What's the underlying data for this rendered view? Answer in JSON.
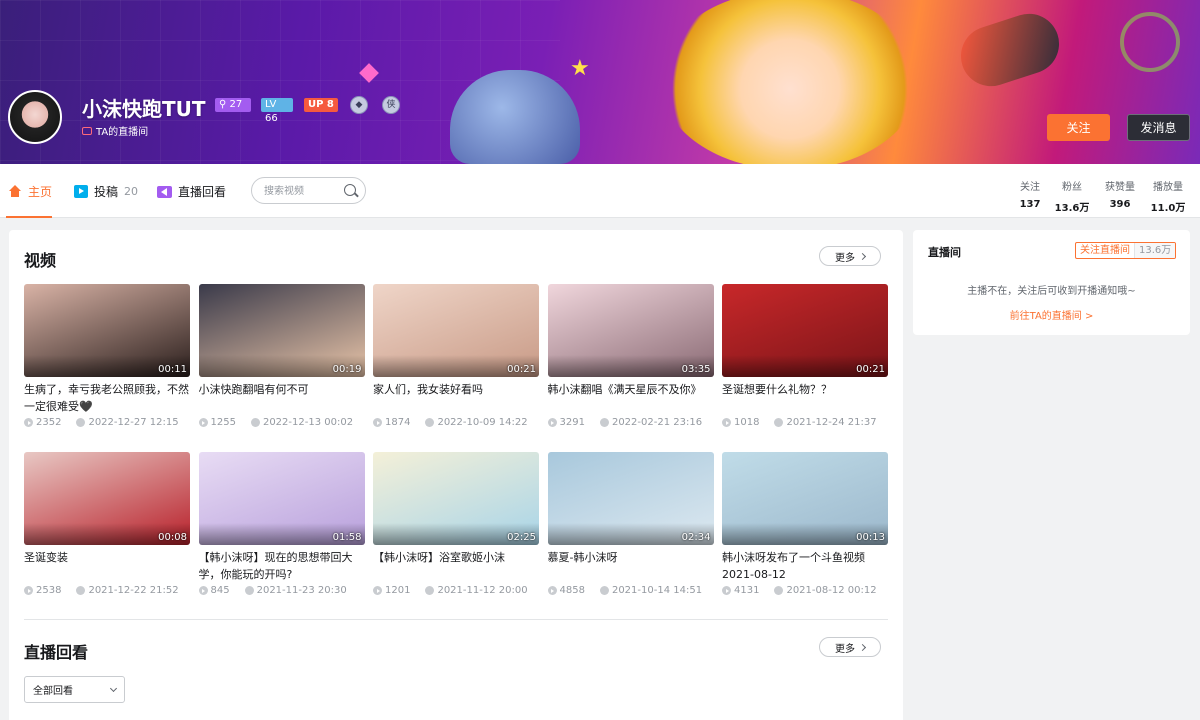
{
  "profile": {
    "name": "小沫快跑TUT",
    "fans_badge": "27",
    "level": "LV 66",
    "up_badge": "UP 8",
    "live_link": "TA的直播间",
    "follow_btn": "关注",
    "message_btn": "发消息"
  },
  "nav": {
    "home": "主页",
    "posts": "投稿",
    "posts_count": "20",
    "replay": "直播回看",
    "search_placeholder": "搜索视频"
  },
  "stats": [
    {
      "label": "关注",
      "value": "137"
    },
    {
      "label": "粉丝",
      "value": "13.6万"
    },
    {
      "label": "获赞量",
      "value": "396"
    },
    {
      "label": "播放量",
      "value": "11.0万"
    }
  ],
  "videos_section": {
    "title": "视频",
    "more": "更多"
  },
  "videos": [
    {
      "title": "生病了，幸亏我老公照顾我，不然一定很难受🖤",
      "duration": "00:11",
      "plays": "2352",
      "date": "2022-12-27 12:15",
      "color_a": "#d9b3a6",
      "color_b": "#2a1e1c"
    },
    {
      "title": "小沫快跑翻唱有何不可",
      "duration": "00:19",
      "plays": "1255",
      "date": "2022-12-13 00:02",
      "color_a": "#3a3a4a",
      "color_b": "#e8c4a8"
    },
    {
      "title": "家人们，我女装好看吗",
      "duration": "00:21",
      "plays": "1874",
      "date": "2022-10-09 14:22",
      "color_a": "#efd5c8",
      "color_b": "#c89a86"
    },
    {
      "title": "韩小沫翻唱《满天星辰不及你》",
      "duration": "03:35",
      "plays": "3291",
      "date": "2022-02-21 23:16",
      "color_a": "#f0d6dc",
      "color_b": "#8a6a74"
    },
    {
      "title": "圣诞想要什么礼物？？",
      "duration": "00:21",
      "plays": "1018",
      "date": "2021-12-24 21:37",
      "color_a": "#c8282a",
      "color_b": "#7a1418"
    },
    {
      "title": "圣诞变装",
      "duration": "00:08",
      "plays": "2538",
      "date": "2021-12-22 21:52",
      "color_a": "#e8c8c4",
      "color_b": "#b8202a"
    },
    {
      "title": "【韩小沫呀】现在的思想带回大学，你能玩的开吗?",
      "duration": "01:58",
      "plays": "845",
      "date": "2021-11-23 20:30",
      "color_a": "#e8dcf4",
      "color_b": "#b8a0dc"
    },
    {
      "title": "【韩小沫呀】浴室歌姬小沫",
      "duration": "02:25",
      "plays": "1201",
      "date": "2021-11-12 20:00",
      "color_a": "#f4f0d8",
      "color_b": "#a8d4e8"
    },
    {
      "title": "慕夏-韩小沫呀",
      "duration": "02:34",
      "plays": "4858",
      "date": "2021-10-14 14:51",
      "color_a": "#a8c8dc",
      "color_b": "#dce8f0"
    },
    {
      "title": "韩小沫呀发布了一个斗鱼视频2021-08-12",
      "duration": "00:13",
      "plays": "4131",
      "date": "2021-08-12 00:12",
      "color_a": "#c0dce8",
      "color_b": "#9cb8cc"
    }
  ],
  "replay_section": {
    "title": "直播回看",
    "more": "更多",
    "filter": "全部回看"
  },
  "live_room": {
    "title": "直播间",
    "follow_label": "关注直播间",
    "follow_count": "13.6万",
    "message": "主播不在，关注后可收到开播通知哦~",
    "link": "前往TA的直播间 >"
  },
  "colors": {
    "accent": "#fb7232",
    "blue": "#00aeec",
    "purple": "#a35cf0"
  }
}
